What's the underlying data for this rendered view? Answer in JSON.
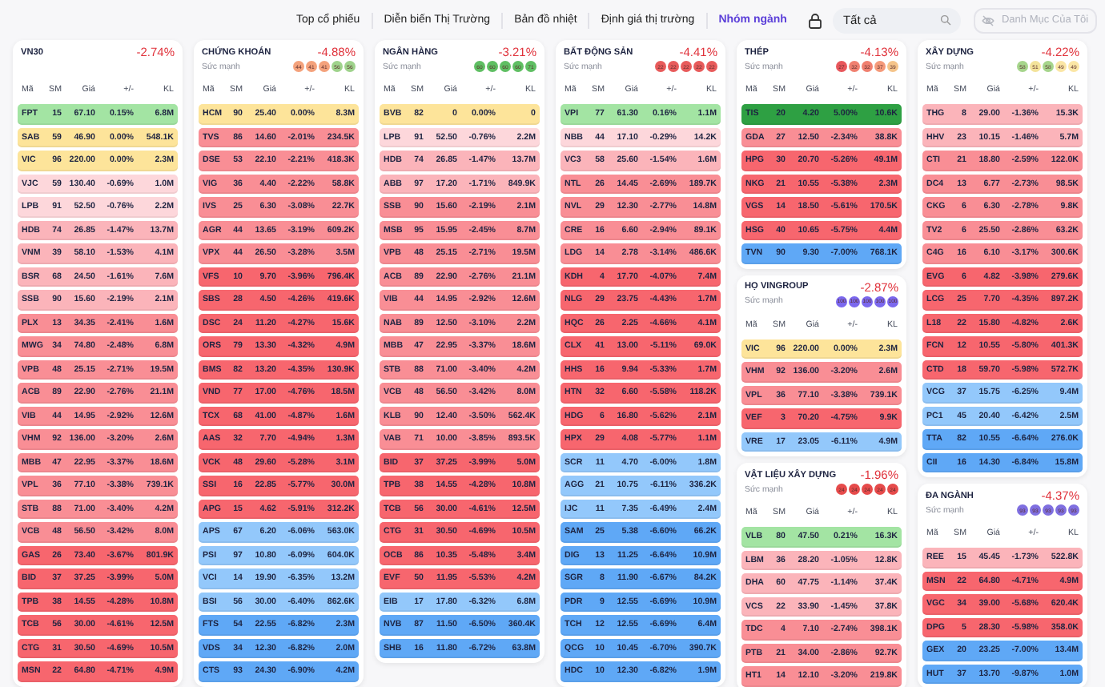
{
  "nav": {
    "tabs": [
      {
        "label": "Top cổ phiếu",
        "selected": false
      },
      {
        "label": "Diễn biến Thị Trường",
        "selected": false
      },
      {
        "label": "Bản đồ nhiệt",
        "selected": false
      },
      {
        "label": "Định giá thị trường",
        "selected": false
      },
      {
        "label": "Nhóm ngành",
        "selected": true
      }
    ],
    "search": {
      "value": "Tất cả"
    },
    "my_list_button": {
      "label": "Danh Mục Của Tôi",
      "disabled": true
    }
  },
  "columns": [
    {
      "panels": [
        {
          "title": "VN30",
          "change": "-2.74%",
          "headers": [
            "Mã",
            "SM",
            "Giá",
            "+/-",
            "KL"
          ],
          "rows": [
            {
              "code": "FPT",
              "sm": "15",
              "price": "67.10",
              "change": "0.15%",
              "volume": "6.8M",
              "color": "#a3e4a3"
            },
            {
              "code": "SAB",
              "sm": "59",
              "price": "46.90",
              "change": "0.00%",
              "volume": "548.1K",
              "color": "#fde49a"
            },
            {
              "code": "VIC",
              "sm": "96",
              "price": "220.00",
              "change": "0.00%",
              "volume": "2.3M",
              "color": "#fde49a"
            },
            {
              "code": "VJC",
              "sm": "59",
              "price": "130.40",
              "change": "-0.69%",
              "volume": "1.0M",
              "color": "#fdd7db"
            },
            {
              "code": "LPB",
              "sm": "91",
              "price": "52.50",
              "change": "-0.76%",
              "volume": "2.2M",
              "color": "#fdd7db"
            },
            {
              "code": "HDB",
              "sm": "74",
              "price": "26.85",
              "change": "-1.47%",
              "volume": "13.7M",
              "color": "#fbb4ba"
            },
            {
              "code": "VNM",
              "sm": "39",
              "price": "58.10",
              "change": "-1.53%",
              "volume": "4.1M",
              "color": "#fbb4ba"
            },
            {
              "code": "BSR",
              "sm": "68",
              "price": "24.50",
              "change": "-1.61%",
              "volume": "7.6M",
              "color": "#fbb4ba"
            },
            {
              "code": "SSB",
              "sm": "90",
              "price": "15.60",
              "change": "-2.19%",
              "volume": "2.1M",
              "color": "#fbb4ba"
            },
            {
              "code": "PLX",
              "sm": "13",
              "price": "34.35",
              "change": "-2.41%",
              "volume": "1.6M",
              "color": "#f98e95"
            },
            {
              "code": "MWG",
              "sm": "34",
              "price": "74.80",
              "change": "-2.48%",
              "volume": "6.8M",
              "color": "#f98e95"
            },
            {
              "code": "VPB",
              "sm": "48",
              "price": "25.15",
              "change": "-2.71%",
              "volume": "19.5M",
              "color": "#f98e95"
            },
            {
              "code": "ACB",
              "sm": "89",
              "price": "22.90",
              "change": "-2.76%",
              "volume": "21.1M",
              "color": "#f98e95"
            },
            {
              "code": "VIB",
              "sm": "44",
              "price": "14.95",
              "change": "-2.92%",
              "volume": "12.6M",
              "color": "#f98e95"
            },
            {
              "code": "VHM",
              "sm": "92",
              "price": "136.00",
              "change": "-3.20%",
              "volume": "2.6M",
              "color": "#f98e95"
            },
            {
              "code": "MBB",
              "sm": "47",
              "price": "22.95",
              "change": "-3.37%",
              "volume": "18.6M",
              "color": "#f98e95"
            },
            {
              "code": "VPL",
              "sm": "36",
              "price": "77.10",
              "change": "-3.38%",
              "volume": "739.1K",
              "color": "#f98e95"
            },
            {
              "code": "STB",
              "sm": "88",
              "price": "71.00",
              "change": "-3.40%",
              "volume": "4.2M",
              "color": "#f98e95"
            },
            {
              "code": "VCB",
              "sm": "48",
              "price": "56.50",
              "change": "-3.42%",
              "volume": "8.0M",
              "color": "#f98e95"
            },
            {
              "code": "GAS",
              "sm": "26",
              "price": "73.40",
              "change": "-3.67%",
              "volume": "801.9K",
              "color": "#f7666e"
            },
            {
              "code": "BID",
              "sm": "37",
              "price": "37.25",
              "change": "-3.99%",
              "volume": "5.0M",
              "color": "#f7666e"
            },
            {
              "code": "TPB",
              "sm": "38",
              "price": "14.55",
              "change": "-4.28%",
              "volume": "10.8M",
              "color": "#f7666e"
            },
            {
              "code": "TCB",
              "sm": "56",
              "price": "30.00",
              "change": "-4.61%",
              "volume": "12.5M",
              "color": "#f7666e"
            },
            {
              "code": "CTG",
              "sm": "31",
              "price": "30.50",
              "change": "-4.69%",
              "volume": "10.5M",
              "color": "#f7666e"
            },
            {
              "code": "MSN",
              "sm": "22",
              "price": "64.80",
              "change": "-4.71%",
              "volume": "4.9M",
              "color": "#f7666e"
            }
          ]
        }
      ]
    },
    {
      "panels": [
        {
          "title": "CHỨNG KHOÁN",
          "change": "-4.88%",
          "strength": {
            "label": "Sức mạnh",
            "dots": [
              {
                "value": "44",
                "color": "#f4a27c"
              },
              {
                "value": "41",
                "color": "#f4a27c"
              },
              {
                "value": "41",
                "color": "#f4a27c"
              },
              {
                "value": "56",
                "color": "#9fd38c"
              },
              {
                "value": "56",
                "color": "#9fd38c"
              }
            ]
          },
          "headers": [
            "Mã",
            "SM",
            "Giá",
            "+/-",
            "KL"
          ],
          "rows": [
            {
              "code": "HCM",
              "sm": "90",
              "price": "25.40",
              "change": "0.00%",
              "volume": "8.3M",
              "color": "#fde49a"
            },
            {
              "code": "TVS",
              "sm": "86",
              "price": "14.60",
              "change": "-2.01%",
              "volume": "234.5K",
              "color": "#f98e95"
            },
            {
              "code": "DSE",
              "sm": "53",
              "price": "22.10",
              "change": "-2.21%",
              "volume": "418.3K",
              "color": "#f98e95"
            },
            {
              "code": "VIG",
              "sm": "36",
              "price": "4.40",
              "change": "-2.22%",
              "volume": "58.8K",
              "color": "#f98e95"
            },
            {
              "code": "IVS",
              "sm": "25",
              "price": "6.30",
              "change": "-3.08%",
              "volume": "22.7K",
              "color": "#f98e95"
            },
            {
              "code": "AGR",
              "sm": "44",
              "price": "13.65",
              "change": "-3.19%",
              "volume": "609.2K",
              "color": "#f98e95"
            },
            {
              "code": "VPX",
              "sm": "44",
              "price": "26.50",
              "change": "-3.28%",
              "volume": "3.5M",
              "color": "#f98e95"
            },
            {
              "code": "VFS",
              "sm": "10",
              "price": "9.70",
              "change": "-3.96%",
              "volume": "796.4K",
              "color": "#f7666e"
            },
            {
              "code": "SBS",
              "sm": "28",
              "price": "4.50",
              "change": "-4.26%",
              "volume": "419.6K",
              "color": "#f7666e"
            },
            {
              "code": "DSC",
              "sm": "24",
              "price": "11.20",
              "change": "-4.27%",
              "volume": "15.6K",
              "color": "#f7666e"
            },
            {
              "code": "ORS",
              "sm": "79",
              "price": "13.30",
              "change": "-4.32%",
              "volume": "4.9M",
              "color": "#f7666e"
            },
            {
              "code": "BMS",
              "sm": "82",
              "price": "13.20",
              "change": "-4.35%",
              "volume": "130.9K",
              "color": "#f7666e"
            },
            {
              "code": "VND",
              "sm": "77",
              "price": "17.00",
              "change": "-4.76%",
              "volume": "18.5M",
              "color": "#f7666e"
            },
            {
              "code": "TCX",
              "sm": "68",
              "price": "41.00",
              "change": "-4.87%",
              "volume": "1.6M",
              "color": "#f7666e"
            },
            {
              "code": "AAS",
              "sm": "32",
              "price": "7.70",
              "change": "-4.94%",
              "volume": "1.3M",
              "color": "#f7666e"
            },
            {
              "code": "VCK",
              "sm": "48",
              "price": "29.60",
              "change": "-5.28%",
              "volume": "3.1M",
              "color": "#f7666e"
            },
            {
              "code": "SSI",
              "sm": "16",
              "price": "22.85",
              "change": "-5.77%",
              "volume": "30.0M",
              "color": "#f7666e"
            },
            {
              "code": "APG",
              "sm": "15",
              "price": "4.62",
              "change": "-5.91%",
              "volume": "312.2K",
              "color": "#f7666e"
            },
            {
              "code": "APS",
              "sm": "67",
              "price": "6.20",
              "change": "-6.06%",
              "volume": "563.0K",
              "color": "#93c8fb"
            },
            {
              "code": "PSI",
              "sm": "97",
              "price": "10.80",
              "change": "-6.09%",
              "volume": "604.0K",
              "color": "#93c8fb"
            },
            {
              "code": "VCI",
              "sm": "14",
              "price": "19.90",
              "change": "-6.35%",
              "volume": "13.2M",
              "color": "#93c8fb"
            },
            {
              "code": "BSI",
              "sm": "56",
              "price": "30.00",
              "change": "-6.40%",
              "volume": "862.6K",
              "color": "#93c8fb"
            },
            {
              "code": "FTS",
              "sm": "54",
              "price": "22.55",
              "change": "-6.82%",
              "volume": "2.3M",
              "color": "#5fa8f6"
            },
            {
              "code": "VDS",
              "sm": "34",
              "price": "12.30",
              "change": "-6.82%",
              "volume": "2.0M",
              "color": "#5fa8f6"
            },
            {
              "code": "CTS",
              "sm": "93",
              "price": "24.30",
              "change": "-6.90%",
              "volume": "4.2M",
              "color": "#5fa8f6"
            }
          ]
        }
      ]
    },
    {
      "panels": [
        {
          "title": "NGÂN HÀNG",
          "change": "-3.21%",
          "strength": {
            "label": "Sức mạnh",
            "dots": [
              {
                "value": "60",
                "color": "#5fbf63"
              },
              {
                "value": "60",
                "color": "#5fbf63"
              },
              {
                "value": "60",
                "color": "#5fbf63"
              },
              {
                "value": "60",
                "color": "#5fbf63"
              },
              {
                "value": "71",
                "color": "#5fbf63"
              }
            ]
          },
          "headers": [
            "Mã",
            "SM",
            "Giá",
            "+/-",
            "KL"
          ],
          "rows": [
            {
              "code": "BVB",
              "sm": "82",
              "price": "0",
              "change": "0.00%",
              "volume": "0",
              "color": "#fde49a"
            },
            {
              "code": "LPB",
              "sm": "91",
              "price": "52.50",
              "change": "-0.76%",
              "volume": "2.2M",
              "color": "#fdd7db"
            },
            {
              "code": "HDB",
              "sm": "74",
              "price": "26.85",
              "change": "-1.47%",
              "volume": "13.7M",
              "color": "#fbb4ba"
            },
            {
              "code": "ABB",
              "sm": "97",
              "price": "17.20",
              "change": "-1.71%",
              "volume": "849.9K",
              "color": "#fbb4ba"
            },
            {
              "code": "SSB",
              "sm": "90",
              "price": "15.60",
              "change": "-2.19%",
              "volume": "2.1M",
              "color": "#f98e95"
            },
            {
              "code": "MSB",
              "sm": "95",
              "price": "15.95",
              "change": "-2.45%",
              "volume": "8.7M",
              "color": "#f98e95"
            },
            {
              "code": "VPB",
              "sm": "48",
              "price": "25.15",
              "change": "-2.71%",
              "volume": "19.5M",
              "color": "#f98e95"
            },
            {
              "code": "ACB",
              "sm": "89",
              "price": "22.90",
              "change": "-2.76%",
              "volume": "21.1M",
              "color": "#f98e95"
            },
            {
              "code": "VIB",
              "sm": "44",
              "price": "14.95",
              "change": "-2.92%",
              "volume": "12.6M",
              "color": "#f98e95"
            },
            {
              "code": "NAB",
              "sm": "89",
              "price": "12.50",
              "change": "-3.10%",
              "volume": "2.2M",
              "color": "#f98e95"
            },
            {
              "code": "MBB",
              "sm": "47",
              "price": "22.95",
              "change": "-3.37%",
              "volume": "18.6M",
              "color": "#f98e95"
            },
            {
              "code": "STB",
              "sm": "88",
              "price": "71.00",
              "change": "-3.40%",
              "volume": "4.2M",
              "color": "#f98e95"
            },
            {
              "code": "VCB",
              "sm": "48",
              "price": "56.50",
              "change": "-3.42%",
              "volume": "8.0M",
              "color": "#f98e95"
            },
            {
              "code": "KLB",
              "sm": "90",
              "price": "12.40",
              "change": "-3.50%",
              "volume": "562.4K",
              "color": "#f98e95"
            },
            {
              "code": "VAB",
              "sm": "71",
              "price": "10.00",
              "change": "-3.85%",
              "volume": "893.5K",
              "color": "#f98e95"
            },
            {
              "code": "BID",
              "sm": "37",
              "price": "37.25",
              "change": "-3.99%",
              "volume": "5.0M",
              "color": "#f7666e"
            },
            {
              "code": "TPB",
              "sm": "38",
              "price": "14.55",
              "change": "-4.28%",
              "volume": "10.8M",
              "color": "#f7666e"
            },
            {
              "code": "TCB",
              "sm": "56",
              "price": "30.00",
              "change": "-4.61%",
              "volume": "12.5M",
              "color": "#f7666e"
            },
            {
              "code": "CTG",
              "sm": "31",
              "price": "30.50",
              "change": "-4.69%",
              "volume": "10.5M",
              "color": "#f7666e"
            },
            {
              "code": "OCB",
              "sm": "86",
              "price": "10.35",
              "change": "-5.48%",
              "volume": "3.4M",
              "color": "#f7666e"
            },
            {
              "code": "EVF",
              "sm": "50",
              "price": "11.95",
              "change": "-5.53%",
              "volume": "4.2M",
              "color": "#f7666e"
            },
            {
              "code": "EIB",
              "sm": "17",
              "price": "17.80",
              "change": "-6.32%",
              "volume": "6.8M",
              "color": "#93c8fb"
            },
            {
              "code": "NVB",
              "sm": "87",
              "price": "11.50",
              "change": "-6.50%",
              "volume": "360.4K",
              "color": "#5fa8f6"
            },
            {
              "code": "SHB",
              "sm": "16",
              "price": "11.80",
              "change": "-6.72%",
              "volume": "63.8M",
              "color": "#5fa8f6"
            }
          ]
        }
      ]
    },
    {
      "panels": [
        {
          "title": "BẤT ĐỘNG SẢN",
          "change": "-4.41%",
          "strength": {
            "label": "Sức mạnh",
            "dots": [
              {
                "value": "22",
                "color": "#e85b5b"
              },
              {
                "value": "22",
                "color": "#e85b5b"
              },
              {
                "value": "22",
                "color": "#e85b5b"
              },
              {
                "value": "22",
                "color": "#e85b5b"
              },
              {
                "value": "22",
                "color": "#e85b5b"
              }
            ]
          },
          "headers": [
            "Mã",
            "SM",
            "Giá",
            "+/-",
            "KL"
          ],
          "rows": [
            {
              "code": "VPI",
              "sm": "77",
              "price": "61.30",
              "change": "0.16%",
              "volume": "1.1M",
              "color": "#a3e4a3"
            },
            {
              "code": "NBB",
              "sm": "44",
              "price": "17.10",
              "change": "-0.29%",
              "volume": "14.2K",
              "color": "#fdd7db"
            },
            {
              "code": "VC3",
              "sm": "58",
              "price": "25.60",
              "change": "-1.54%",
              "volume": "1.6M",
              "color": "#fbb4ba"
            },
            {
              "code": "NTL",
              "sm": "26",
              "price": "14.45",
              "change": "-2.69%",
              "volume": "189.7K",
              "color": "#f98e95"
            },
            {
              "code": "NVL",
              "sm": "29",
              "price": "12.30",
              "change": "-2.77%",
              "volume": "14.8M",
              "color": "#f98e95"
            },
            {
              "code": "CRE",
              "sm": "16",
              "price": "6.60",
              "change": "-2.94%",
              "volume": "89.1K",
              "color": "#f98e95"
            },
            {
              "code": "LDG",
              "sm": "14",
              "price": "2.78",
              "change": "-3.14%",
              "volume": "486.6K",
              "color": "#f98e95"
            },
            {
              "code": "KDH",
              "sm": "4",
              "price": "17.70",
              "change": "-4.07%",
              "volume": "7.4M",
              "color": "#f7666e"
            },
            {
              "code": "NLG",
              "sm": "29",
              "price": "23.75",
              "change": "-4.43%",
              "volume": "1.7M",
              "color": "#f7666e"
            },
            {
              "code": "HQC",
              "sm": "26",
              "price": "2.25",
              "change": "-4.66%",
              "volume": "4.1M",
              "color": "#f7666e"
            },
            {
              "code": "CLX",
              "sm": "41",
              "price": "13.00",
              "change": "-5.11%",
              "volume": "69.0K",
              "color": "#f7666e"
            },
            {
              "code": "HHS",
              "sm": "16",
              "price": "9.94",
              "change": "-5.33%",
              "volume": "1.7M",
              "color": "#f7666e"
            },
            {
              "code": "HTN",
              "sm": "32",
              "price": "6.60",
              "change": "-5.58%",
              "volume": "118.2K",
              "color": "#f7666e"
            },
            {
              "code": "HDG",
              "sm": "6",
              "price": "16.80",
              "change": "-5.62%",
              "volume": "2.1M",
              "color": "#f7666e"
            },
            {
              "code": "HPX",
              "sm": "29",
              "price": "4.08",
              "change": "-5.77%",
              "volume": "1.1M",
              "color": "#f7666e"
            },
            {
              "code": "SCR",
              "sm": "11",
              "price": "4.70",
              "change": "-6.00%",
              "volume": "1.8M",
              "color": "#93c8fb"
            },
            {
              "code": "AGG",
              "sm": "21",
              "price": "10.75",
              "change": "-6.11%",
              "volume": "336.2K",
              "color": "#93c8fb"
            },
            {
              "code": "IJC",
              "sm": "11",
              "price": "7.35",
              "change": "-6.49%",
              "volume": "2.4M",
              "color": "#93c8fb"
            },
            {
              "code": "SAM",
              "sm": "25",
              "price": "5.38",
              "change": "-6.60%",
              "volume": "66.2K",
              "color": "#5fa8f6"
            },
            {
              "code": "DIG",
              "sm": "13",
              "price": "11.25",
              "change": "-6.64%",
              "volume": "10.9M",
              "color": "#5fa8f6"
            },
            {
              "code": "SGR",
              "sm": "8",
              "price": "11.90",
              "change": "-6.67%",
              "volume": "84.2K",
              "color": "#5fa8f6"
            },
            {
              "code": "PDR",
              "sm": "9",
              "price": "12.55",
              "change": "-6.69%",
              "volume": "10.9M",
              "color": "#5fa8f6"
            },
            {
              "code": "TCH",
              "sm": "12",
              "price": "12.55",
              "change": "-6.69%",
              "volume": "6.4M",
              "color": "#5fa8f6"
            },
            {
              "code": "QCG",
              "sm": "10",
              "price": "10.45",
              "change": "-6.70%",
              "volume": "390.7K",
              "color": "#5fa8f6"
            },
            {
              "code": "HDC",
              "sm": "10",
              "price": "12.30",
              "change": "-6.82%",
              "volume": "1.9M",
              "color": "#5fa8f6"
            }
          ]
        }
      ]
    },
    {
      "panels": [
        {
          "title": "THÉP",
          "change": "-4.13%",
          "strength": {
            "label": "Sức mạnh",
            "dots": [
              {
                "value": "27",
                "color": "#e8575c"
              },
              {
                "value": "32",
                "color": "#f08070"
              },
              {
                "value": "32",
                "color": "#f08070"
              },
              {
                "value": "37",
                "color": "#f59a7a"
              },
              {
                "value": "39",
                "color": "#f5c48a"
              }
            ]
          },
          "headers": [
            "Mã",
            "SM",
            "Giá",
            "+/-",
            "KL"
          ],
          "rows": [
            {
              "code": "TIS",
              "sm": "20",
              "price": "4.20",
              "change": "5.00%",
              "volume": "10.6K",
              "color": "#2ea043"
            },
            {
              "code": "GDA",
              "sm": "27",
              "price": "12.50",
              "change": "-2.34%",
              "volume": "38.8K",
              "color": "#f98e95"
            },
            {
              "code": "HPG",
              "sm": "30",
              "price": "20.70",
              "change": "-5.26%",
              "volume": "49.1M",
              "color": "#f7666e"
            },
            {
              "code": "NKG",
              "sm": "21",
              "price": "10.55",
              "change": "-5.38%",
              "volume": "2.3M",
              "color": "#f7666e"
            },
            {
              "code": "VGS",
              "sm": "14",
              "price": "18.50",
              "change": "-5.61%",
              "volume": "170.5K",
              "color": "#f7666e"
            },
            {
              "code": "HSG",
              "sm": "40",
              "price": "10.65",
              "change": "-5.75%",
              "volume": "4.4M",
              "color": "#f7666e"
            },
            {
              "code": "TVN",
              "sm": "90",
              "price": "9.30",
              "change": "-7.00%",
              "volume": "768.1K",
              "color": "#5fa8f6"
            }
          ]
        },
        {
          "title": "HỌ VINGROUP",
          "change": "-2.87%",
          "strength": {
            "label": "Sức mạnh",
            "dots": [
              {
                "value": "100",
                "color": "#7b68ee"
              },
              {
                "value": "100",
                "color": "#7b68ee"
              },
              {
                "value": "100",
                "color": "#7b68ee"
              },
              {
                "value": "100",
                "color": "#7b68ee"
              },
              {
                "value": "100",
                "color": "#7b68ee"
              }
            ]
          },
          "headers": [
            "Mã",
            "SM",
            "Giá",
            "+/-",
            "KL"
          ],
          "rows": [
            {
              "code": "VIC",
              "sm": "96",
              "price": "220.00",
              "change": "0.00%",
              "volume": "2.3M",
              "color": "#fde49a"
            },
            {
              "code": "VHM",
              "sm": "92",
              "price": "136.00",
              "change": "-3.20%",
              "volume": "2.6M",
              "color": "#f98e95"
            },
            {
              "code": "VPL",
              "sm": "36",
              "price": "77.10",
              "change": "-3.38%",
              "volume": "739.1K",
              "color": "#f98e95"
            },
            {
              "code": "VEF",
              "sm": "3",
              "price": "70.20",
              "change": "-4.75%",
              "volume": "9.9K",
              "color": "#f7666e"
            },
            {
              "code": "VRE",
              "sm": "17",
              "price": "23.05",
              "change": "-6.11%",
              "volume": "4.9M",
              "color": "#93c8fb"
            }
          ]
        },
        {
          "title": "VẬT LIỆU XÂY DỰNG",
          "change": "-1.96%",
          "strength": {
            "label": "Sức mạnh",
            "dots": [
              {
                "value": "24",
                "color": "#e64b4b"
              },
              {
                "value": "24",
                "color": "#e64b4b"
              },
              {
                "value": "24",
                "color": "#e64b4b"
              },
              {
                "value": "24",
                "color": "#e64b4b"
              },
              {
                "value": "24",
                "color": "#e64b4b"
              }
            ]
          },
          "headers": [
            "Mã",
            "SM",
            "Giá",
            "+/-",
            "KL"
          ],
          "rows": [
            {
              "code": "VLB",
              "sm": "80",
              "price": "47.50",
              "change": "0.21%",
              "volume": "16.3K",
              "color": "#a3e4a3"
            },
            {
              "code": "LBM",
              "sm": "36",
              "price": "28.20",
              "change": "-1.05%",
              "volume": "12.8K",
              "color": "#fbb4ba"
            },
            {
              "code": "DHA",
              "sm": "60",
              "price": "47.75",
              "change": "-1.14%",
              "volume": "37.4K",
              "color": "#fbb4ba"
            },
            {
              "code": "VCS",
              "sm": "22",
              "price": "33.90",
              "change": "-1.45%",
              "volume": "37.8K",
              "color": "#fbb4ba"
            },
            {
              "code": "TDC",
              "sm": "4",
              "price": "7.10",
              "change": "-2.74%",
              "volume": "398.1K",
              "color": "#f98e95"
            },
            {
              "code": "PTB",
              "sm": "21",
              "price": "34.00",
              "change": "-2.86%",
              "volume": "92.7K",
              "color": "#f98e95"
            },
            {
              "code": "HT1",
              "sm": "14",
              "price": "12.10",
              "change": "-3.20%",
              "volume": "219.8K",
              "color": "#f98e95"
            }
          ]
        }
      ]
    },
    {
      "panels": [
        {
          "title": "XÂY DỰNG",
          "change": "-4.22%",
          "strength": {
            "label": "Sức mạnh",
            "dots": [
              {
                "value": "58",
                "color": "#a6d58c"
              },
              {
                "value": "51",
                "color": "#f3e39a"
              },
              {
                "value": "58",
                "color": "#a6d58c"
              },
              {
                "value": "49",
                "color": "#fbe6a5"
              },
              {
                "value": "49",
                "color": "#fbe6a5"
              }
            ]
          },
          "headers": [
            "Mã",
            "SM",
            "Giá",
            "+/-",
            "KL"
          ],
          "rows": [
            {
              "code": "THG",
              "sm": "8",
              "price": "29.00",
              "change": "-1.36%",
              "volume": "15.3K",
              "color": "#fbb4ba"
            },
            {
              "code": "HHV",
              "sm": "23",
              "price": "10.15",
              "change": "-1.46%",
              "volume": "5.7M",
              "color": "#fbb4ba"
            },
            {
              "code": "CTI",
              "sm": "21",
              "price": "18.80",
              "change": "-2.59%",
              "volume": "122.0K",
              "color": "#f98e95"
            },
            {
              "code": "DC4",
              "sm": "13",
              "price": "6.77",
              "change": "-2.73%",
              "volume": "98.5K",
              "color": "#f98e95"
            },
            {
              "code": "CKG",
              "sm": "6",
              "price": "6.30",
              "change": "-2.78%",
              "volume": "9.8K",
              "color": "#f98e95"
            },
            {
              "code": "TV2",
              "sm": "6",
              "price": "25.50",
              "change": "-2.86%",
              "volume": "63.2K",
              "color": "#f98e95"
            },
            {
              "code": "C4G",
              "sm": "16",
              "price": "6.10",
              "change": "-3.17%",
              "volume": "300.6K",
              "color": "#f98e95"
            },
            {
              "code": "EVG",
              "sm": "6",
              "price": "4.82",
              "change": "-3.98%",
              "volume": "279.6K",
              "color": "#f7666e"
            },
            {
              "code": "LCG",
              "sm": "25",
              "price": "7.70",
              "change": "-4.35%",
              "volume": "897.2K",
              "color": "#f7666e"
            },
            {
              "code": "L18",
              "sm": "22",
              "price": "15.80",
              "change": "-4.82%",
              "volume": "2.6K",
              "color": "#f7666e"
            },
            {
              "code": "FCN",
              "sm": "12",
              "price": "10.55",
              "change": "-5.80%",
              "volume": "401.3K",
              "color": "#f7666e"
            },
            {
              "code": "CTD",
              "sm": "18",
              "price": "59.70",
              "change": "-5.98%",
              "volume": "572.7K",
              "color": "#f7666e"
            },
            {
              "code": "VCG",
              "sm": "37",
              "price": "15.75",
              "change": "-6.25%",
              "volume": "9.4M",
              "color": "#93c8fb"
            },
            {
              "code": "PC1",
              "sm": "45",
              "price": "20.40",
              "change": "-6.42%",
              "volume": "2.5M",
              "color": "#93c8fb"
            },
            {
              "code": "TTA",
              "sm": "82",
              "price": "10.55",
              "change": "-6.64%",
              "volume": "276.0K",
              "color": "#5fa8f6"
            },
            {
              "code": "CII",
              "sm": "16",
              "price": "14.30",
              "change": "-6.84%",
              "volume": "15.8M",
              "color": "#5fa8f6"
            }
          ]
        },
        {
          "title": "ĐA NGÀNH",
          "change": "-4.37%",
          "strength": {
            "label": "Sức mạnh",
            "dots": [
              {
                "value": "93",
                "color": "#7f6fe0"
              },
              {
                "value": "93",
                "color": "#7f6fe0"
              },
              {
                "value": "93",
                "color": "#7f6fe0"
              },
              {
                "value": "93",
                "color": "#7f6fe0"
              },
              {
                "value": "93",
                "color": "#7f6fe0"
              }
            ]
          },
          "headers": [
            "Mã",
            "SM",
            "Giá",
            "+/-",
            "KL"
          ],
          "rows": [
            {
              "code": "REE",
              "sm": "15",
              "price": "45.45",
              "change": "-1.73%",
              "volume": "522.8K",
              "color": "#fbb4ba"
            },
            {
              "code": "MSN",
              "sm": "22",
              "price": "64.80",
              "change": "-4.71%",
              "volume": "4.9M",
              "color": "#f7666e"
            },
            {
              "code": "VGC",
              "sm": "34",
              "price": "39.00",
              "change": "-5.68%",
              "volume": "620.4K",
              "color": "#f7666e"
            },
            {
              "code": "DPG",
              "sm": "5",
              "price": "28.30",
              "change": "-5.98%",
              "volume": "358.0K",
              "color": "#f7666e"
            },
            {
              "code": "GEX",
              "sm": "20",
              "price": "23.25",
              "change": "-7.00%",
              "volume": "13.4M",
              "color": "#5fa8f6"
            },
            {
              "code": "HUT",
              "sm": "37",
              "price": "13.70",
              "change": "-9.87%",
              "volume": "1.0M",
              "color": "#5fa8f6"
            }
          ]
        }
      ]
    }
  ]
}
